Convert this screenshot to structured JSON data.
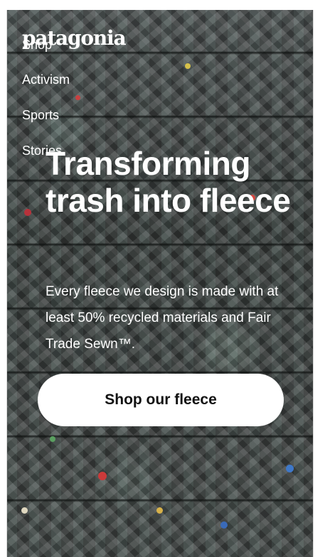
{
  "brand": {
    "logo_text": "patagonia"
  },
  "nav": {
    "items": [
      {
        "label": "Shop"
      },
      {
        "label": "Activism"
      },
      {
        "label": "Sports"
      },
      {
        "label": "Stories"
      }
    ]
  },
  "hero": {
    "headline": "Transforming trash into fleece",
    "description": "Every fleece we design is made with at least 50% recycled materials and Fair Trade Sewn™.",
    "cta_label": "Shop our fleece",
    "background": "photo of compressed recycled plastic bottle bales"
  },
  "colors": {
    "text": "#ffffff",
    "button_bg": "#ffffff",
    "button_text": "#111111"
  }
}
